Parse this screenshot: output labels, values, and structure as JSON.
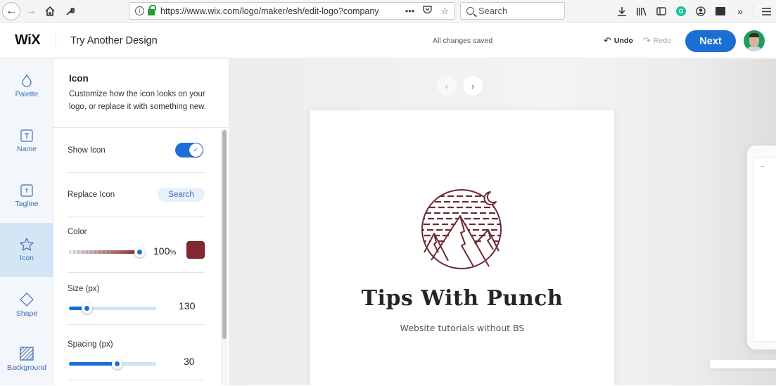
{
  "browser": {
    "url": "https://www.wix.com/logo/maker/esh/edit-logo?company",
    "search_placeholder": "Search",
    "url_actions": [
      "more-icon",
      "pocket-icon",
      "bookmark-star-icon"
    ],
    "toolbar_icons": [
      "download-icon",
      "library-icon",
      "sidebar-icon",
      "grammarly-icon",
      "account-icon",
      "extension-icon",
      "overflow-icon",
      "menu-icon"
    ],
    "grammarly_letter": "G"
  },
  "header": {
    "logo": "WiX",
    "try_another": "Try Another Design",
    "status": "All changes saved",
    "undo_label": "Undo",
    "redo_label": "Redo",
    "next_label": "Next"
  },
  "rail": {
    "items": [
      {
        "label": "Palette",
        "icon": "palette-drop-icon",
        "active": false
      },
      {
        "label": "Name",
        "icon": "text-t-icon",
        "active": false
      },
      {
        "label": "Tagline",
        "icon": "text-t-small-icon",
        "active": false
      },
      {
        "label": "Icon",
        "icon": "star-icon",
        "active": true
      },
      {
        "label": "Shape",
        "icon": "diamond-icon",
        "active": false
      },
      {
        "label": "Background",
        "icon": "hatched-square-icon",
        "active": false
      }
    ]
  },
  "panel": {
    "title": "Icon",
    "description": "Customize how the icon looks on your logo, or replace it with something new.",
    "show_icon": {
      "label": "Show Icon",
      "on": true
    },
    "replace_icon": {
      "label": "Replace Icon",
      "button": "Search"
    },
    "color": {
      "label": "Color",
      "opacity_percent": 100,
      "opacity_value": "100",
      "unit": "%",
      "swatch": "#842830"
    },
    "size": {
      "label": "Size (px)",
      "value": "130",
      "fraction": 0.2
    },
    "spacing": {
      "label": "Spacing (px)",
      "value": "30",
      "fraction": 0.55
    }
  },
  "canvas": {
    "prev_icon": "‹",
    "next_icon": "›",
    "logo": {
      "name": "Tips With Punch",
      "tagline": "Website tutorials without BS",
      "icon_color": "#6e2a32"
    },
    "device_back_icon": "←"
  },
  "colors": {
    "accent": "#1b6fd4",
    "rail_active": "#d4e6f6",
    "rail_text": "#3b6db3",
    "icon_color": "#842830"
  }
}
